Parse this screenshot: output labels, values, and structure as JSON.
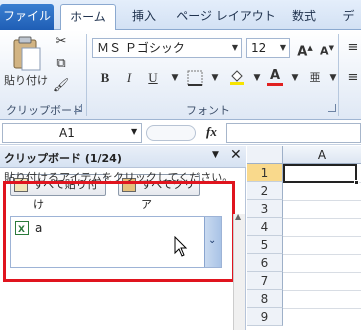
{
  "tabs": [
    "ファイル",
    "ホーム",
    "挿入",
    "ページ レイアウト",
    "数式",
    "デ"
  ],
  "ribbon": {
    "paste_label": "貼り付け",
    "clipboard_group": "クリップボード",
    "font_name": "ＭＳ Ｐゴシック",
    "font_size": "12",
    "font_group": "フォント",
    "bold": "B",
    "italic": "I",
    "underline": "U",
    "grow_font": "A",
    "shrink_font": "A",
    "font_color_letter": "A",
    "phonetic_letter": "亜"
  },
  "formula_bar": {
    "name_box": "A1",
    "fx": "fx"
  },
  "clipboard_pane": {
    "title": "クリップボード (1/24)",
    "paste_all": "すべて貼り付け",
    "clear_all": "すべてクリア",
    "instruction": "貼り付けるアイテムをクリックしてください。",
    "items": [
      {
        "text": "a"
      }
    ]
  },
  "sheet": {
    "column": "A",
    "rows": [
      "1",
      "2",
      "3",
      "4",
      "5",
      "6",
      "7",
      "8",
      "9"
    ]
  },
  "colors": {
    "highlight_box": "#e0141e",
    "file_tab": "#2a6fc9",
    "font_color_bar": "#e02020",
    "fill_color_bar": "#f7e400"
  }
}
